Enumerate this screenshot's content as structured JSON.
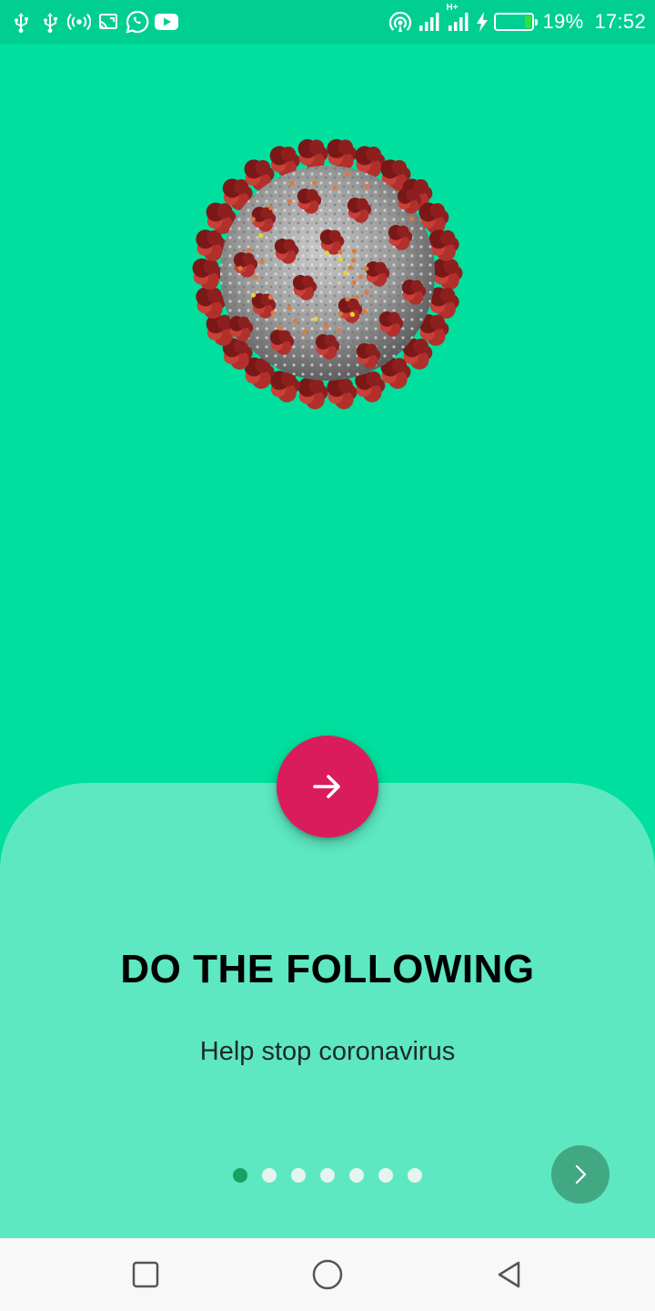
{
  "status_bar": {
    "battery_percent": "19%",
    "battery_level": 0.19,
    "time": "17:52",
    "network_type": "H+",
    "left_icons": [
      "usb-icon",
      "usb-icon",
      "hotspot-icon",
      "screen-cast-icon",
      "whatsapp-icon",
      "youtube-icon"
    ],
    "right_icons": [
      "wifi-hotspot-icon",
      "signal-icon",
      "signal-icon",
      "charging-icon",
      "battery-icon"
    ],
    "battery_color": "#30e040"
  },
  "hero": {
    "image": "coronavirus-icon"
  },
  "onboarding": {
    "title": "DO THE FOLLOWING",
    "subtitle": "Help stop coronavirus",
    "page_count": 7,
    "current_page": 1,
    "fab_icon": "arrow-right-icon",
    "next_icon": "chevron-right-icon"
  },
  "colors": {
    "background": "#00df9d",
    "status_bar": "#00cf91",
    "card": "#5de8c1",
    "fab": "#da1c5c",
    "dot_active": "#17a062",
    "dot_inactive": "#e6f4ef",
    "next_button": "#42a883"
  },
  "nav_bar": {
    "buttons": [
      "recents-icon",
      "home-icon",
      "back-icon"
    ]
  }
}
